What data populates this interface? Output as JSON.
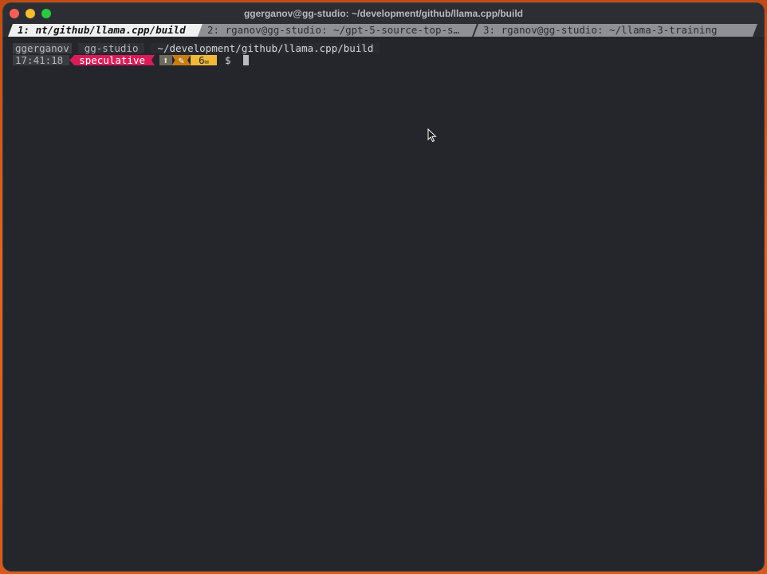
{
  "window": {
    "title": "ggerganov@gg-studio: ~/development/github/llama.cpp/build"
  },
  "tabs": [
    {
      "label": "1: nt/github/llama.cpp/build"
    },
    {
      "label": "2: rganov@gg-studio: ~/gpt-5-source-top-s…"
    },
    {
      "label": "3: rganov@gg-studio: ~/llama-3-training"
    }
  ],
  "prompt": {
    "user": "ggerganov",
    "host": "gg-studio",
    "path": "~/development/github/llama.cpp/build",
    "time": "17:41:18",
    "branch": "speculative",
    "ahead_icon": "⬆",
    "dirty_icon": "✎",
    "stash_label": "6",
    "stash_icon": "✉",
    "symbol": "$"
  },
  "colors": {
    "branch": "#d81c5a",
    "dirty": "#c77d12",
    "stash": "#f1b93a",
    "terminal_bg": "#24262c"
  },
  "icons": {
    "close": "close-icon",
    "minimize": "minimize-icon",
    "maximize": "maximize-icon",
    "pointer": "mouse-pointer-icon"
  }
}
